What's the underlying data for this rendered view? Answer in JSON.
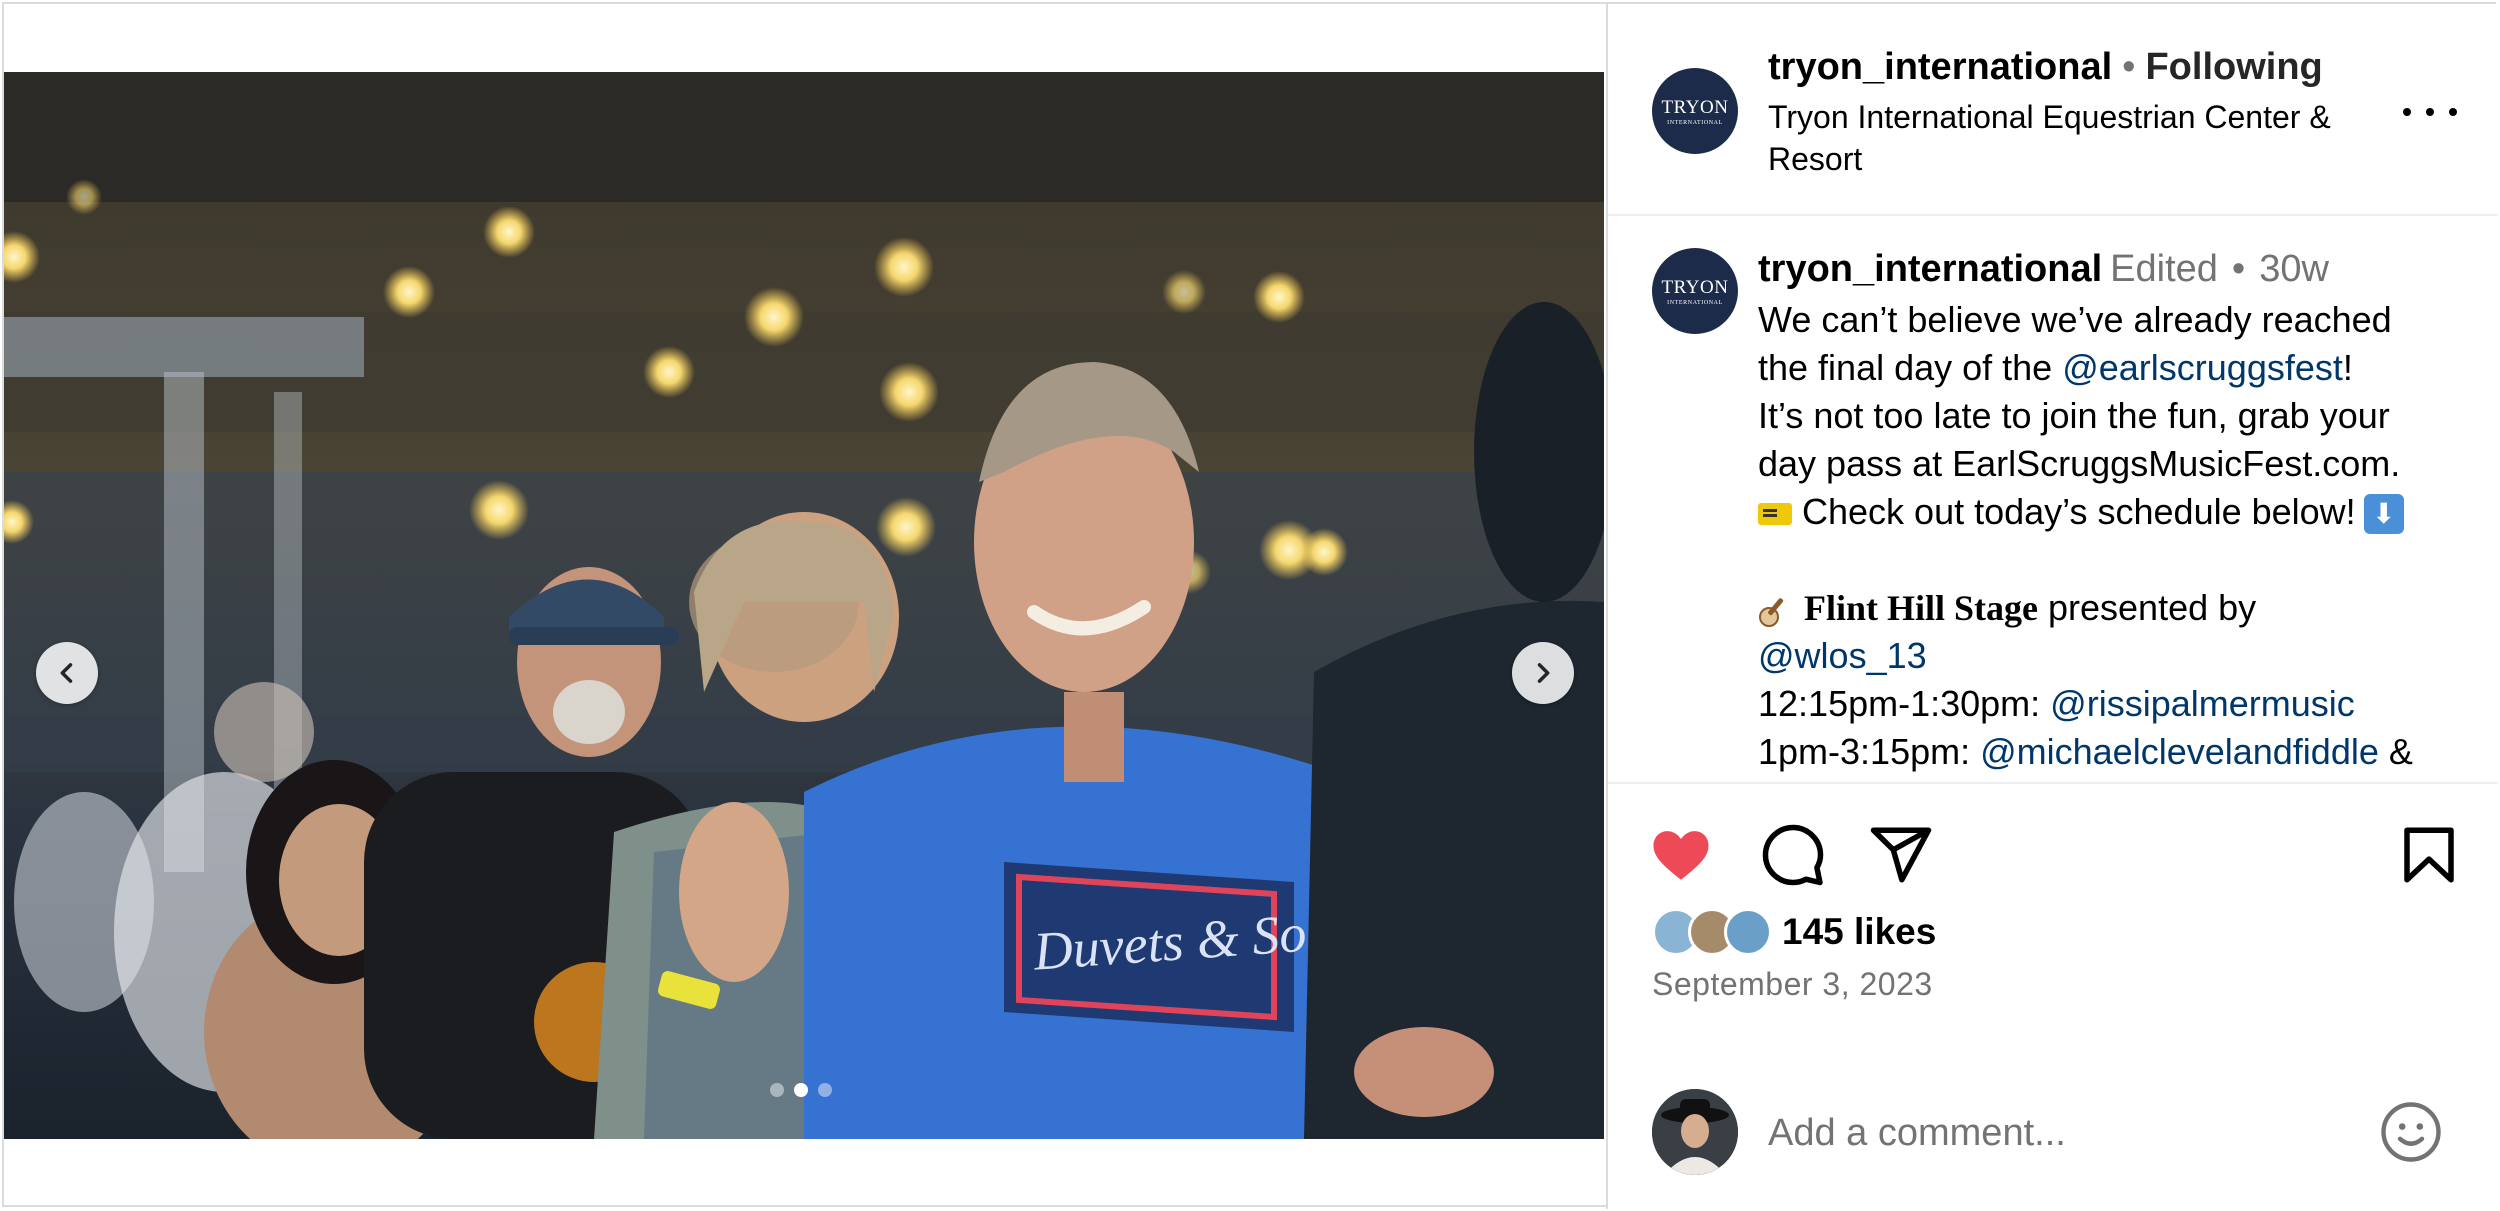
{
  "post": {
    "username": "tryon_international",
    "follow_sep": "•",
    "follow_label": "Following",
    "location": "Tryon International Equestrian Center & Resort",
    "logo_text": "TRYON",
    "logo_sub": "INTERNATIONAL"
  },
  "caption": {
    "username": "tryon_international",
    "edited": "Edited",
    "sep": "•",
    "age": "30w",
    "lines": {
      "l1": "We can’t believe we’ve already reached",
      "l2a": "the final day of the ",
      "l2_mention": "@earlscruggsfest",
      "l2b": "!",
      "l3": "It’s not too late to join the fun, grab your",
      "l4": "day pass at EarlScruggsMusicFest.com.",
      "l5": "Check out today’s schedule below!",
      "l6_stage": "Flint Hill Stage",
      "l6b": " presented by",
      "l7_mention": "@wlos_13",
      "l8a": "12:15pm-1:30pm: ",
      "l8_mention": "@rissipalmermusic",
      "l9a": "1pm-3:15pm: ",
      "l9_mention": "@michaelclevelandfiddle",
      "l9b": " &"
    },
    "down_arrow": "⬇"
  },
  "engagement": {
    "likes": "145 likes",
    "date": "September 3, 2023",
    "liked": true
  },
  "comment": {
    "placeholder": "Add a comment..."
  },
  "carousel": {
    "total": 3,
    "active": 2
  },
  "icons": [
    "chevron-left-icon",
    "chevron-right-icon",
    "more-icon",
    "heart-icon",
    "comment-icon",
    "share-icon",
    "bookmark-icon",
    "smile-icon"
  ],
  "colors": {
    "heart": "#ed4956",
    "mention": "#00376b",
    "muted": "#737373",
    "logo_bg": "#1d2b4a"
  }
}
